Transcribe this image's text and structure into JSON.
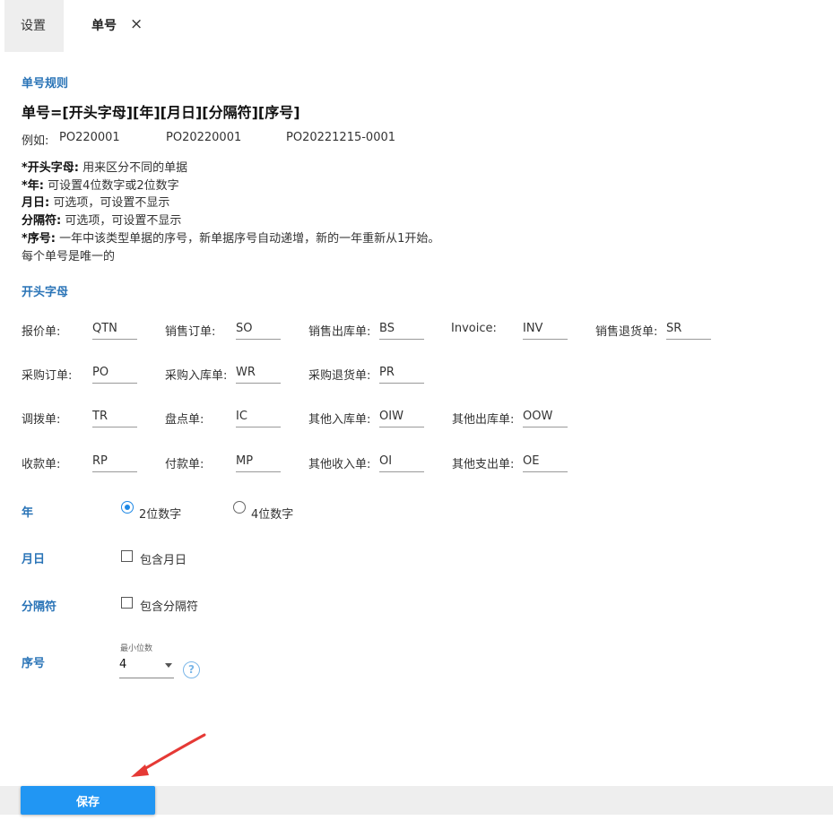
{
  "tabs": {
    "settings": "设置",
    "number": "单号",
    "close": "×"
  },
  "rule": {
    "title": "单号规则",
    "formula": "单号=[开头字母][年][月日][分隔符][序号]",
    "example_label": "例如:",
    "examples": [
      "PO220001",
      "PO20220001",
      "PO20221215-0001"
    ],
    "descriptions": [
      {
        "key": "*开头字母:",
        "text": "用来区分不同的单据"
      },
      {
        "key": "*年:",
        "text": "可设置4位数字或2位数字"
      },
      {
        "key": "月日:",
        "text": "可选项，可设置不显示"
      },
      {
        "key": "分隔符:",
        "text": "可选项，可设置不显示"
      },
      {
        "key": "*序号:",
        "text": "一年中该类型单据的序号，新单据序号自动递增，新的一年重新从1开始。"
      }
    ],
    "unique_note": "每个单号是唯一的"
  },
  "prefix": {
    "title": "开头字母",
    "rows": [
      [
        {
          "label": "报价单:",
          "value": "QTN"
        },
        {
          "label": "销售订单:",
          "value": "SO"
        },
        {
          "label": "销售出库单:",
          "value": "BS"
        },
        {
          "label": "Invoice:",
          "value": "INV"
        },
        {
          "label": "销售退货单:",
          "value": "SR"
        }
      ],
      [
        {
          "label": "采购订单:",
          "value": "PO"
        },
        {
          "label": "采购入库单:",
          "value": "WR"
        },
        {
          "label": "采购退货单:",
          "value": "PR"
        }
      ],
      [
        {
          "label": "调拨单:",
          "value": "TR"
        },
        {
          "label": "盘点单:",
          "value": "IC"
        },
        {
          "label": "其他入库单:",
          "value": "OIW"
        },
        {
          "label": "其他出库单:",
          "value": "OOW"
        }
      ],
      [
        {
          "label": "收款单:",
          "value": "RP"
        },
        {
          "label": "付款单:",
          "value": "MP"
        },
        {
          "label": "其他收入单:",
          "value": "OI"
        },
        {
          "label": "其他支出单:",
          "value": "OE"
        }
      ]
    ]
  },
  "year": {
    "label": "年",
    "options": [
      "2位数字",
      "4位数字"
    ],
    "selected": "2位数字"
  },
  "monthday": {
    "label": "月日",
    "checkbox": "包含月日",
    "checked": false
  },
  "separator": {
    "label": "分隔符",
    "checkbox": "包含分隔符",
    "checked": false
  },
  "sequence": {
    "label": "序号",
    "min_digits_label": "最小位数",
    "min_digits_value": "4",
    "help": "?"
  },
  "actions": {
    "save": "保存"
  },
  "colors": {
    "accent": "#2a74b7",
    "button": "#2196f3",
    "arrow": "#e53935"
  }
}
